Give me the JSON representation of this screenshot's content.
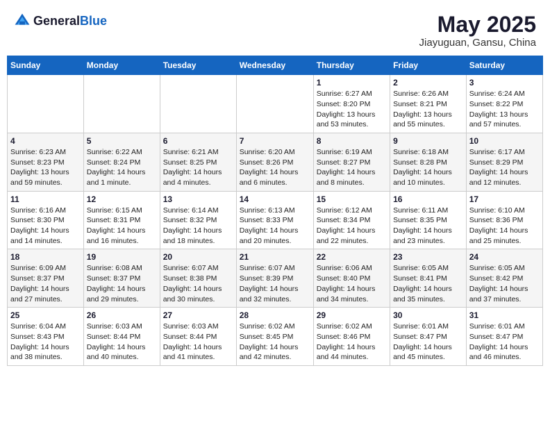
{
  "header": {
    "logo_general": "General",
    "logo_blue": "Blue",
    "month": "May 2025",
    "location": "Jiayuguan, Gansu, China"
  },
  "weekdays": [
    "Sunday",
    "Monday",
    "Tuesday",
    "Wednesday",
    "Thursday",
    "Friday",
    "Saturday"
  ],
  "weeks": [
    [
      {
        "day": "",
        "info": ""
      },
      {
        "day": "",
        "info": ""
      },
      {
        "day": "",
        "info": ""
      },
      {
        "day": "",
        "info": ""
      },
      {
        "day": "1",
        "info": "Sunrise: 6:27 AM\nSunset: 8:20 PM\nDaylight: 13 hours\nand 53 minutes."
      },
      {
        "day": "2",
        "info": "Sunrise: 6:26 AM\nSunset: 8:21 PM\nDaylight: 13 hours\nand 55 minutes."
      },
      {
        "day": "3",
        "info": "Sunrise: 6:24 AM\nSunset: 8:22 PM\nDaylight: 13 hours\nand 57 minutes."
      }
    ],
    [
      {
        "day": "4",
        "info": "Sunrise: 6:23 AM\nSunset: 8:23 PM\nDaylight: 13 hours\nand 59 minutes."
      },
      {
        "day": "5",
        "info": "Sunrise: 6:22 AM\nSunset: 8:24 PM\nDaylight: 14 hours\nand 1 minute."
      },
      {
        "day": "6",
        "info": "Sunrise: 6:21 AM\nSunset: 8:25 PM\nDaylight: 14 hours\nand 4 minutes."
      },
      {
        "day": "7",
        "info": "Sunrise: 6:20 AM\nSunset: 8:26 PM\nDaylight: 14 hours\nand 6 minutes."
      },
      {
        "day": "8",
        "info": "Sunrise: 6:19 AM\nSunset: 8:27 PM\nDaylight: 14 hours\nand 8 minutes."
      },
      {
        "day": "9",
        "info": "Sunrise: 6:18 AM\nSunset: 8:28 PM\nDaylight: 14 hours\nand 10 minutes."
      },
      {
        "day": "10",
        "info": "Sunrise: 6:17 AM\nSunset: 8:29 PM\nDaylight: 14 hours\nand 12 minutes."
      }
    ],
    [
      {
        "day": "11",
        "info": "Sunrise: 6:16 AM\nSunset: 8:30 PM\nDaylight: 14 hours\nand 14 minutes."
      },
      {
        "day": "12",
        "info": "Sunrise: 6:15 AM\nSunset: 8:31 PM\nDaylight: 14 hours\nand 16 minutes."
      },
      {
        "day": "13",
        "info": "Sunrise: 6:14 AM\nSunset: 8:32 PM\nDaylight: 14 hours\nand 18 minutes."
      },
      {
        "day": "14",
        "info": "Sunrise: 6:13 AM\nSunset: 8:33 PM\nDaylight: 14 hours\nand 20 minutes."
      },
      {
        "day": "15",
        "info": "Sunrise: 6:12 AM\nSunset: 8:34 PM\nDaylight: 14 hours\nand 22 minutes."
      },
      {
        "day": "16",
        "info": "Sunrise: 6:11 AM\nSunset: 8:35 PM\nDaylight: 14 hours\nand 23 minutes."
      },
      {
        "day": "17",
        "info": "Sunrise: 6:10 AM\nSunset: 8:36 PM\nDaylight: 14 hours\nand 25 minutes."
      }
    ],
    [
      {
        "day": "18",
        "info": "Sunrise: 6:09 AM\nSunset: 8:37 PM\nDaylight: 14 hours\nand 27 minutes."
      },
      {
        "day": "19",
        "info": "Sunrise: 6:08 AM\nSunset: 8:37 PM\nDaylight: 14 hours\nand 29 minutes."
      },
      {
        "day": "20",
        "info": "Sunrise: 6:07 AM\nSunset: 8:38 PM\nDaylight: 14 hours\nand 30 minutes."
      },
      {
        "day": "21",
        "info": "Sunrise: 6:07 AM\nSunset: 8:39 PM\nDaylight: 14 hours\nand 32 minutes."
      },
      {
        "day": "22",
        "info": "Sunrise: 6:06 AM\nSunset: 8:40 PM\nDaylight: 14 hours\nand 34 minutes."
      },
      {
        "day": "23",
        "info": "Sunrise: 6:05 AM\nSunset: 8:41 PM\nDaylight: 14 hours\nand 35 minutes."
      },
      {
        "day": "24",
        "info": "Sunrise: 6:05 AM\nSunset: 8:42 PM\nDaylight: 14 hours\nand 37 minutes."
      }
    ],
    [
      {
        "day": "25",
        "info": "Sunrise: 6:04 AM\nSunset: 8:43 PM\nDaylight: 14 hours\nand 38 minutes."
      },
      {
        "day": "26",
        "info": "Sunrise: 6:03 AM\nSunset: 8:44 PM\nDaylight: 14 hours\nand 40 minutes."
      },
      {
        "day": "27",
        "info": "Sunrise: 6:03 AM\nSunset: 8:44 PM\nDaylight: 14 hours\nand 41 minutes."
      },
      {
        "day": "28",
        "info": "Sunrise: 6:02 AM\nSunset: 8:45 PM\nDaylight: 14 hours\nand 42 minutes."
      },
      {
        "day": "29",
        "info": "Sunrise: 6:02 AM\nSunset: 8:46 PM\nDaylight: 14 hours\nand 44 minutes."
      },
      {
        "day": "30",
        "info": "Sunrise: 6:01 AM\nSunset: 8:47 PM\nDaylight: 14 hours\nand 45 minutes."
      },
      {
        "day": "31",
        "info": "Sunrise: 6:01 AM\nSunset: 8:47 PM\nDaylight: 14 hours\nand 46 minutes."
      }
    ]
  ]
}
